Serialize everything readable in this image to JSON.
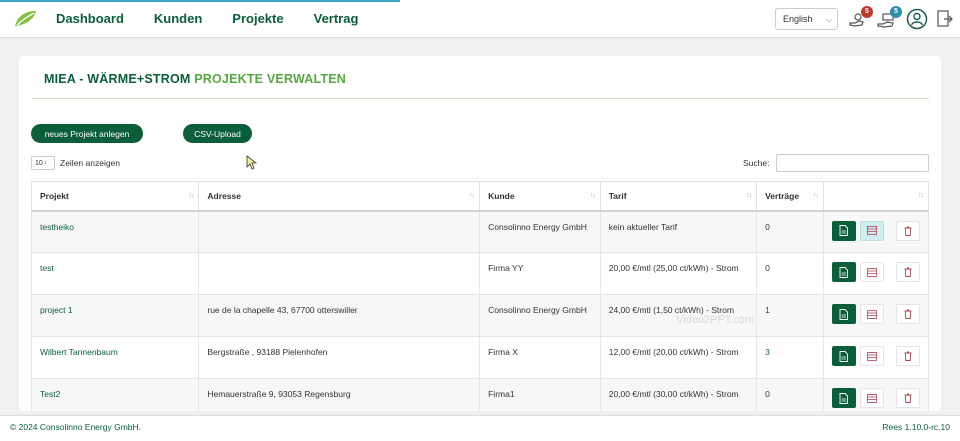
{
  "nav": {
    "items": [
      "Dashboard",
      "Kunden",
      "Projekte",
      "Vertrag"
    ]
  },
  "header": {
    "language": "English",
    "notifications_badge": "5",
    "messages_badge": "5",
    "colors": {
      "badge_red": "#c0392b",
      "badge_teal": "#2a8fa8"
    }
  },
  "page": {
    "title_part1": "MIEA - WÄRME+STROM",
    "title_part2": "PROJEKTE VERWALTEN",
    "new_project_label": "neues Projekt anlegen",
    "csv_upload_label": "CSV-Upload",
    "page_length": "10",
    "page_length_label": "Zeilen anzeigen",
    "search_label": "Suche:",
    "search_value": ""
  },
  "table": {
    "columns": [
      "Projekt",
      "Adresse",
      "Kunde",
      "Tarif",
      "Verträge",
      ""
    ],
    "rows": [
      {
        "projekt": "testheiko",
        "adresse": "",
        "kunde": "Consolinno Energy GmbH",
        "tarif": "kein aktueller Tarif",
        "vertraege": "0"
      },
      {
        "projekt": "test",
        "adresse": "",
        "kunde": "Firma YY",
        "tarif": "20,00 €/mtl (25,00 ct/kWh) - Strom",
        "vertraege": "0"
      },
      {
        "projekt": "project 1",
        "adresse": "rue de la chapelle 43, 67700 otterswiller",
        "kunde": "Consolinno Energy GmbH",
        "tarif": "24,00 €/mtl (1,50 ct/kWh) - Strom",
        "vertraege": "1"
      },
      {
        "projekt": "Wilbert Tannenbaum",
        "adresse": "Bergstraße , 93188 Pielenhofen",
        "kunde": "Firma X",
        "tarif": "12,00 €/mtl (20,00 ct/kWh) - Strom",
        "vertraege": "3"
      },
      {
        "projekt": "Test2",
        "adresse": "Hemauerstraße 9, 93053 Regensburg",
        "kunde": "Firma1",
        "tarif": "20,00 €/mtl (30,00 ct/kWh) - Strom",
        "vertraege": "0"
      }
    ]
  },
  "watermark": "Video2PPT.com",
  "footer": {
    "copyright": "© 2024 Consolinno Energy GmbH.",
    "version": "Rees 1.10.0-rc.10"
  },
  "brand_colors": {
    "primary": "#0b5e3a",
    "secondary": "#57a741"
  }
}
